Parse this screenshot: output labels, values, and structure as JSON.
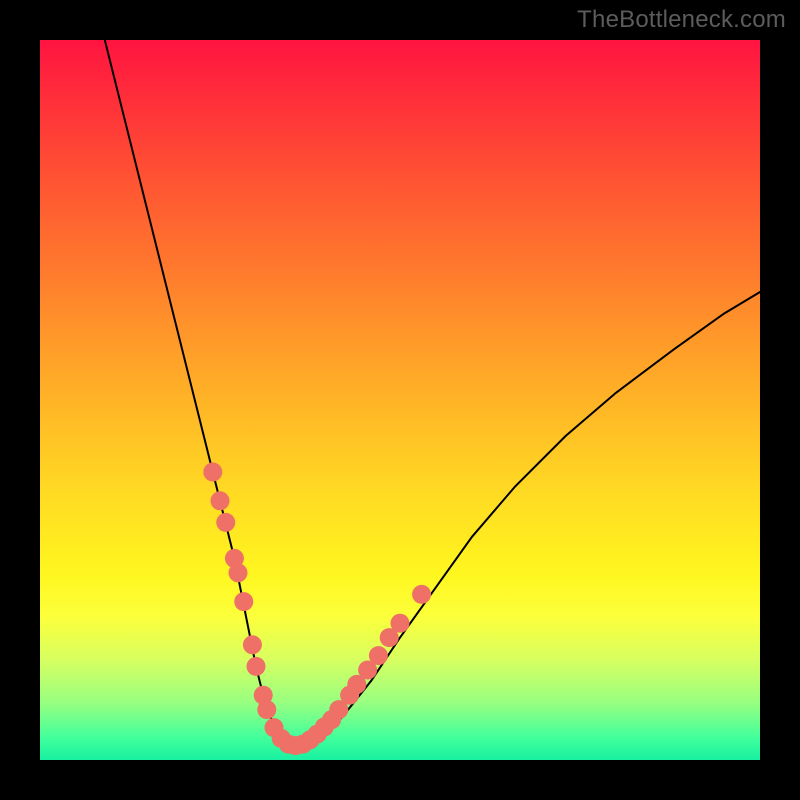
{
  "watermark": "TheBottleneck.com",
  "colors": {
    "frame_bg": "#000000",
    "gradient_top": "#ff1440",
    "gradient_bottom": "#18f0a0",
    "curve": "#000000",
    "marker": "#ee7066",
    "watermark": "#5c5c5c"
  },
  "chart_data": {
    "type": "line",
    "title": "",
    "xlabel": "",
    "ylabel": "",
    "xlim": [
      0,
      100
    ],
    "ylim": [
      0,
      100
    ],
    "grid": false,
    "series": [
      {
        "name": "curve",
        "x": [
          9,
          12,
          15,
          18,
          21,
          24,
          27,
          29,
          30,
          31,
          32,
          33,
          34,
          35,
          36,
          37,
          39,
          42,
          46,
          50,
          55,
          60,
          66,
          73,
          80,
          88,
          95,
          100
        ],
        "y": [
          100,
          88,
          76,
          64,
          52,
          40,
          28,
          18,
          13,
          9,
          6,
          4,
          3,
          2,
          2,
          2,
          3,
          6,
          11,
          17,
          24,
          31,
          38,
          45,
          51,
          57,
          62,
          65
        ]
      }
    ],
    "markers": [
      {
        "x": 24.0,
        "y": 40.0
      },
      {
        "x": 25.0,
        "y": 36.0
      },
      {
        "x": 25.8,
        "y": 33.0
      },
      {
        "x": 27.0,
        "y": 28.0
      },
      {
        "x": 27.5,
        "y": 26.0
      },
      {
        "x": 28.3,
        "y": 22.0
      },
      {
        "x": 29.5,
        "y": 16.0
      },
      {
        "x": 30.0,
        "y": 13.0
      },
      {
        "x": 31.0,
        "y": 9.0
      },
      {
        "x": 31.5,
        "y": 7.0
      },
      {
        "x": 32.5,
        "y": 4.5
      },
      {
        "x": 33.5,
        "y": 3.0
      },
      {
        "x": 34.5,
        "y": 2.2
      },
      {
        "x": 35.5,
        "y": 2.0
      },
      {
        "x": 36.5,
        "y": 2.2
      },
      {
        "x": 37.5,
        "y": 2.8
      },
      {
        "x": 38.5,
        "y": 3.6
      },
      {
        "x": 39.5,
        "y": 4.6
      },
      {
        "x": 40.5,
        "y": 5.6
      },
      {
        "x": 41.5,
        "y": 7.0
      },
      {
        "x": 43.0,
        "y": 9.0
      },
      {
        "x": 44.0,
        "y": 10.5
      },
      {
        "x": 45.5,
        "y": 12.5
      },
      {
        "x": 47.0,
        "y": 14.5
      },
      {
        "x": 48.5,
        "y": 17.0
      },
      {
        "x": 50.0,
        "y": 19.0
      },
      {
        "x": 53.0,
        "y": 23.0
      }
    ],
    "marker_radius_px": 9.5
  }
}
